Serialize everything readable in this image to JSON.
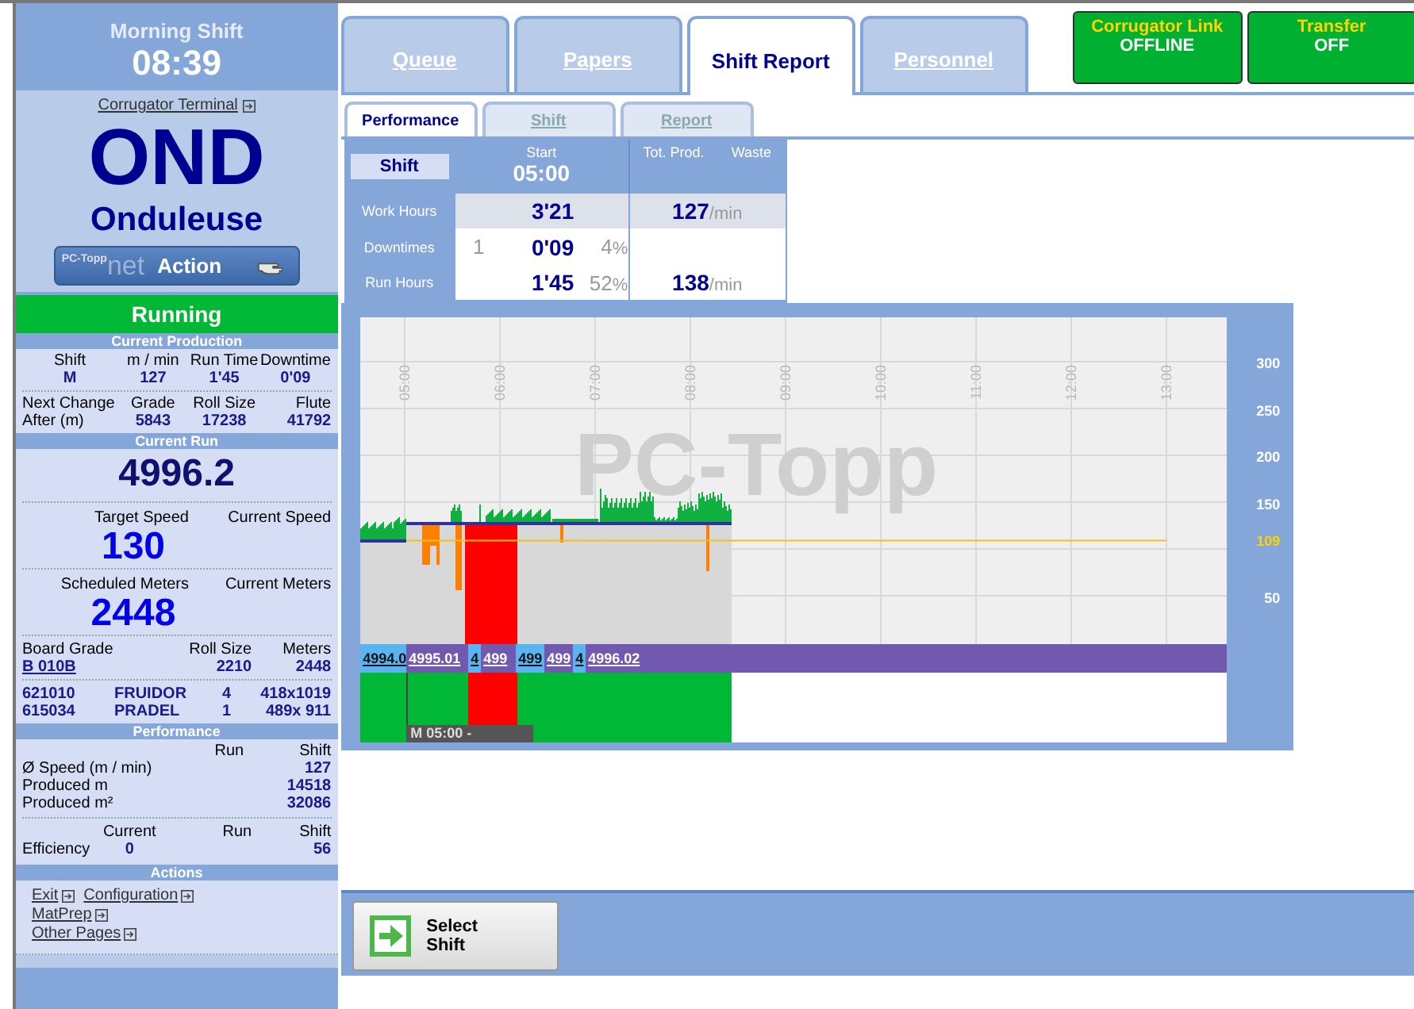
{
  "sidebar": {
    "shift_name": "Morning Shift",
    "time": "08:39",
    "terminal_link": "Corrugator Terminal",
    "machine_code": "OND",
    "machine_name": "Onduleuse",
    "action_button": {
      "brand": "PC-Topp",
      "suffix": "net",
      "label": "Action"
    },
    "status": {
      "label": "Running",
      "kind": "running"
    },
    "current_production": {
      "title": "Current Production",
      "columns": [
        {
          "label": "Shift",
          "value": "M"
        },
        {
          "label": "m / min",
          "value": "127"
        },
        {
          "label": "Run Time",
          "value": "1'45"
        },
        {
          "label": "Downtime",
          "value": "0'09"
        }
      ],
      "next_change_label": "Next Change",
      "after_label": "After (m)",
      "next_columns": [
        {
          "label": "Grade",
          "value": "5843"
        },
        {
          "label": "Roll Size",
          "value": "17238"
        },
        {
          "label": "Flute",
          "value": "41792"
        }
      ]
    },
    "current_run": {
      "title": "Current Run",
      "run_number": "4996.2",
      "target_speed_label": "Target Speed",
      "current_speed_label": "Current Speed",
      "target_speed": "130",
      "scheduled_meters_label": "Scheduled Meters",
      "current_meters_label": "Current Meters",
      "scheduled_meters": "2448",
      "board_grade_label": "Board Grade",
      "roll_size_label": "Roll Size",
      "meters_label": "Meters",
      "board_grade": "B 010B",
      "roll_size": "2210",
      "meters": "2448",
      "orders": [
        {
          "number": "621010",
          "customer": "FRUIDOR",
          "count": "4",
          "size": "418x1019"
        },
        {
          "number": "615034",
          "customer": "PRADEL",
          "count": "1",
          "size": "489x 911"
        }
      ]
    },
    "performance": {
      "title": "Performance",
      "run_label": "Run",
      "shift_label": "Shift",
      "rows": [
        {
          "label": "Ø Speed (m / min)",
          "shift": "127"
        },
        {
          "label": "Produced m",
          "shift": "14518"
        },
        {
          "label": "Produced m²",
          "shift": "32086"
        }
      ]
    },
    "efficiency": {
      "label": "Efficiency",
      "current_label": "Current",
      "run_label": "Run",
      "shift_label": "Shift",
      "current": "0",
      "shift": "56"
    },
    "actions": {
      "title": "Actions",
      "lines": [
        [
          "Exit",
          "Configuration"
        ],
        [
          "MatPrep"
        ],
        [
          "Other Pages"
        ]
      ]
    }
  },
  "tabs": [
    {
      "label": "Queue",
      "selected": false
    },
    {
      "label": "Papers",
      "selected": false
    },
    {
      "label": "Shift Report",
      "selected": true
    },
    {
      "label": "Personnel",
      "selected": false
    }
  ],
  "status_buttons": [
    {
      "title": "Corrugator Link",
      "value": "OFFLINE"
    },
    {
      "title": "Transfer",
      "value": "OFF"
    }
  ],
  "subtabs": [
    {
      "label": "Performance",
      "selected": true
    },
    {
      "label": "Shift",
      "selected": false
    },
    {
      "label": "Report",
      "selected": false
    }
  ],
  "shift_table": {
    "shift_label": "Shift",
    "start_label": "Start",
    "start": "05:00",
    "tot_prod_label": "Tot. Prod.",
    "waste_label": "Waste",
    "rows": [
      {
        "label": "Work Hours",
        "time": "3'21",
        "rate": "127",
        "rate_unit": "/min"
      },
      {
        "label": "Downtimes",
        "count": "1",
        "time": "0'09",
        "percent": "4",
        "percent_unit": "%"
      },
      {
        "label": "Run Hours",
        "time": "1'45",
        "percent": "52",
        "percent_unit": "%",
        "rate": "138",
        "rate_unit": "/min"
      }
    ]
  },
  "chart": {
    "watermark": "PC-Topp",
    "x_labels": [
      "05:00",
      "06:00",
      "07:00",
      "08:00",
      "09:00",
      "10:00",
      "11:00",
      "12:00",
      "13:00"
    ],
    "y_labels": [
      {
        "label": "300",
        "kind": "axis"
      },
      {
        "label": "250",
        "kind": "axis"
      },
      {
        "label": "200",
        "kind": "axis"
      },
      {
        "label": "150",
        "kind": "axis"
      },
      {
        "label": "109",
        "kind": "target"
      },
      {
        "label": "50",
        "kind": "axis"
      }
    ],
    "runs": [
      {
        "label": "4994.0",
        "color": "#5ab4f0"
      },
      {
        "label": "4995.01",
        "color": "#7259b0"
      },
      {
        "label": "4",
        "color": "#5ab4f0"
      },
      {
        "label": "499",
        "color": "#7259b0"
      },
      {
        "label": "499",
        "color": "#5ab4f0"
      },
      {
        "label": "499",
        "color": "#7259b0"
      },
      {
        "label": "4",
        "color": "#5ab4f0"
      },
      {
        "label": "4996.02",
        "color": "#7259b0"
      }
    ],
    "shift_marker": "M 05:00 -"
  },
  "select_button": {
    "label": "Select Shift"
  }
}
